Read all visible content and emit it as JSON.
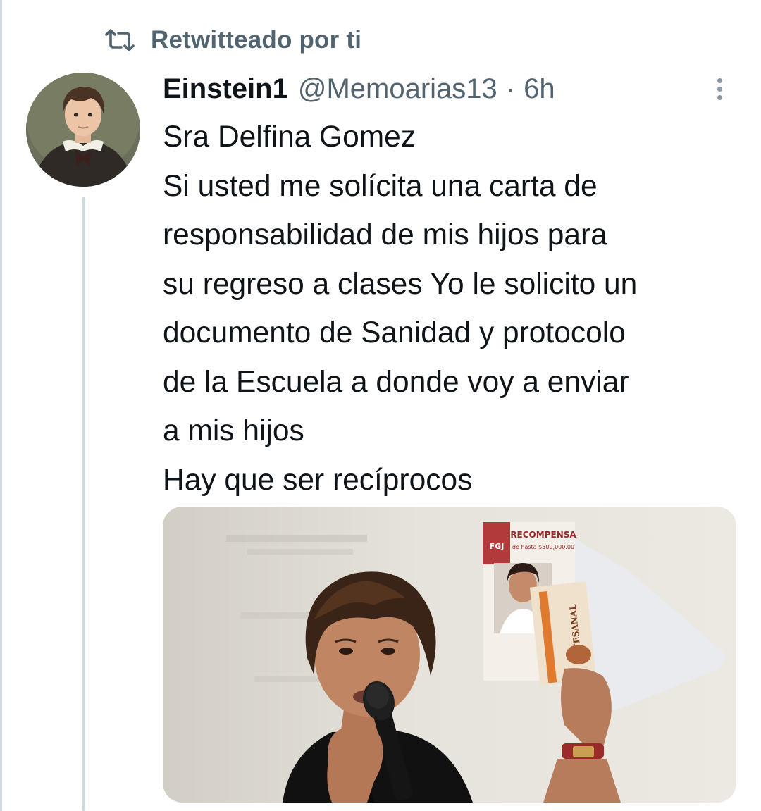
{
  "retweet": {
    "label": "Retwitteado por ti",
    "icon": "retweet-icon"
  },
  "tweet": {
    "author": {
      "display_name": "Einstein1",
      "handle": "@Memoarias13",
      "avatar_icon": "avatar-child-portrait"
    },
    "separator": "·",
    "timestamp": "6h",
    "more_icon": "more-options-icon",
    "text_lines": [
      "Sra Delfina Gomez",
      "Si usted me solícita una carta de",
      "responsabilidad de mis hijos para",
      "su regreso a clases Yo le solicito un",
      "documento de Sanidad y protocolo",
      "de la Escuela a donde voy a enviar",
      "a mis hijos",
      "Hay que ser recíprocos"
    ],
    "media": {
      "poster_title": "RECOMPENSA",
      "poster_subtitle": "de hasta $500,000.00",
      "poster_badge": "FGJ",
      "booklet_title": "ARTESANAL"
    }
  },
  "colors": {
    "text_primary": "#0f1419",
    "text_secondary": "#536471",
    "border": "#cfd9de"
  }
}
